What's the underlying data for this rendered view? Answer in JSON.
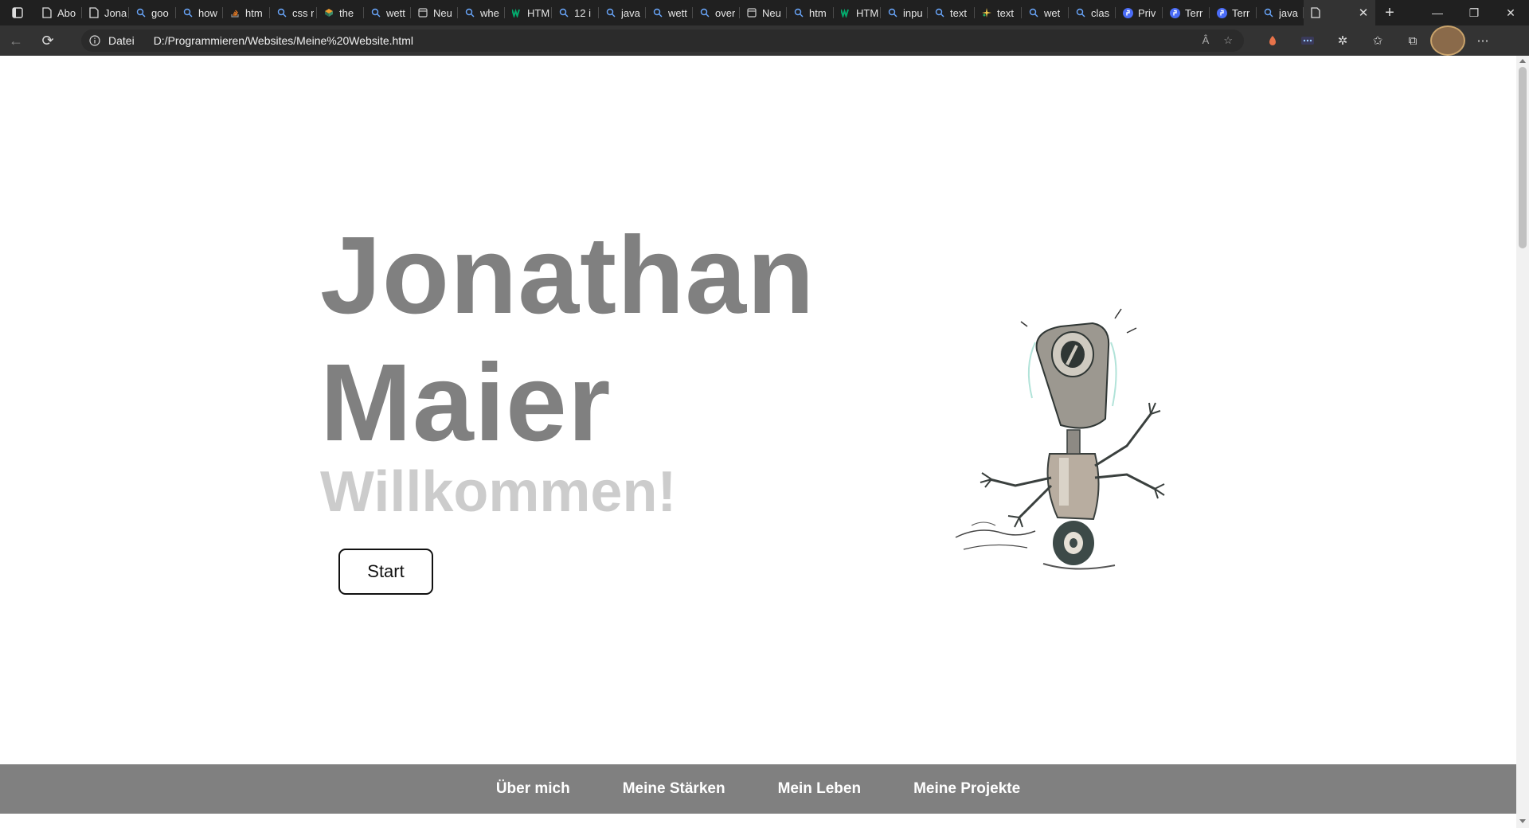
{
  "browser": {
    "tabs": [
      {
        "label": "Abo",
        "icon": "page-icon"
      },
      {
        "label": "Jona",
        "icon": "page-icon"
      },
      {
        "label": "goo",
        "icon": "search-icon"
      },
      {
        "label": "how",
        "icon": "search-icon"
      },
      {
        "label": "htm",
        "icon": "stackoverflow-icon"
      },
      {
        "label": "css r",
        "icon": "search-icon"
      },
      {
        "label": "the",
        "icon": "cube-icon"
      },
      {
        "label": "wett",
        "icon": "search-icon"
      },
      {
        "label": "Neu",
        "icon": "newtab-icon"
      },
      {
        "label": "whe",
        "icon": "search-icon"
      },
      {
        "label": "HTM",
        "icon": "w3schools-icon"
      },
      {
        "label": "12 i",
        "icon": "search-icon"
      },
      {
        "label": "java",
        "icon": "search-icon"
      },
      {
        "label": "wett",
        "icon": "search-icon"
      },
      {
        "label": "over",
        "icon": "search-icon"
      },
      {
        "label": "Neu",
        "icon": "newtab-icon"
      },
      {
        "label": "htm",
        "icon": "search-icon"
      },
      {
        "label": "HTM",
        "icon": "w3schools-icon"
      },
      {
        "label": "inpu",
        "icon": "search-icon"
      },
      {
        "label": "text",
        "icon": "search-icon"
      },
      {
        "label": "text",
        "icon": "sparkle-icon"
      },
      {
        "label": "wet",
        "icon": "search-icon"
      },
      {
        "label": "clas",
        "icon": "search-icon"
      },
      {
        "label": "Priv",
        "icon": "proton-icon"
      },
      {
        "label": "Terr",
        "icon": "proton-icon"
      },
      {
        "label": "Terr",
        "icon": "proton-icon"
      },
      {
        "label": "java",
        "icon": "search-icon"
      }
    ],
    "address_label": "Datei",
    "url": "D:/Programmieren/Websites/Meine%20Website.html",
    "read_aloud_label": "Â"
  },
  "hero": {
    "first_name": "Jonathan",
    "last_name": "Maier",
    "greeting": "Willkommen!",
    "start_button": "Start"
  },
  "nav": {
    "items": [
      "Über mich",
      "Meine Stärken",
      "Mein Leben",
      "Meine Projekte"
    ]
  },
  "colors": {
    "name_color": "#808080",
    "greeting_color": "#cccccc",
    "nav_background": "#808080"
  }
}
